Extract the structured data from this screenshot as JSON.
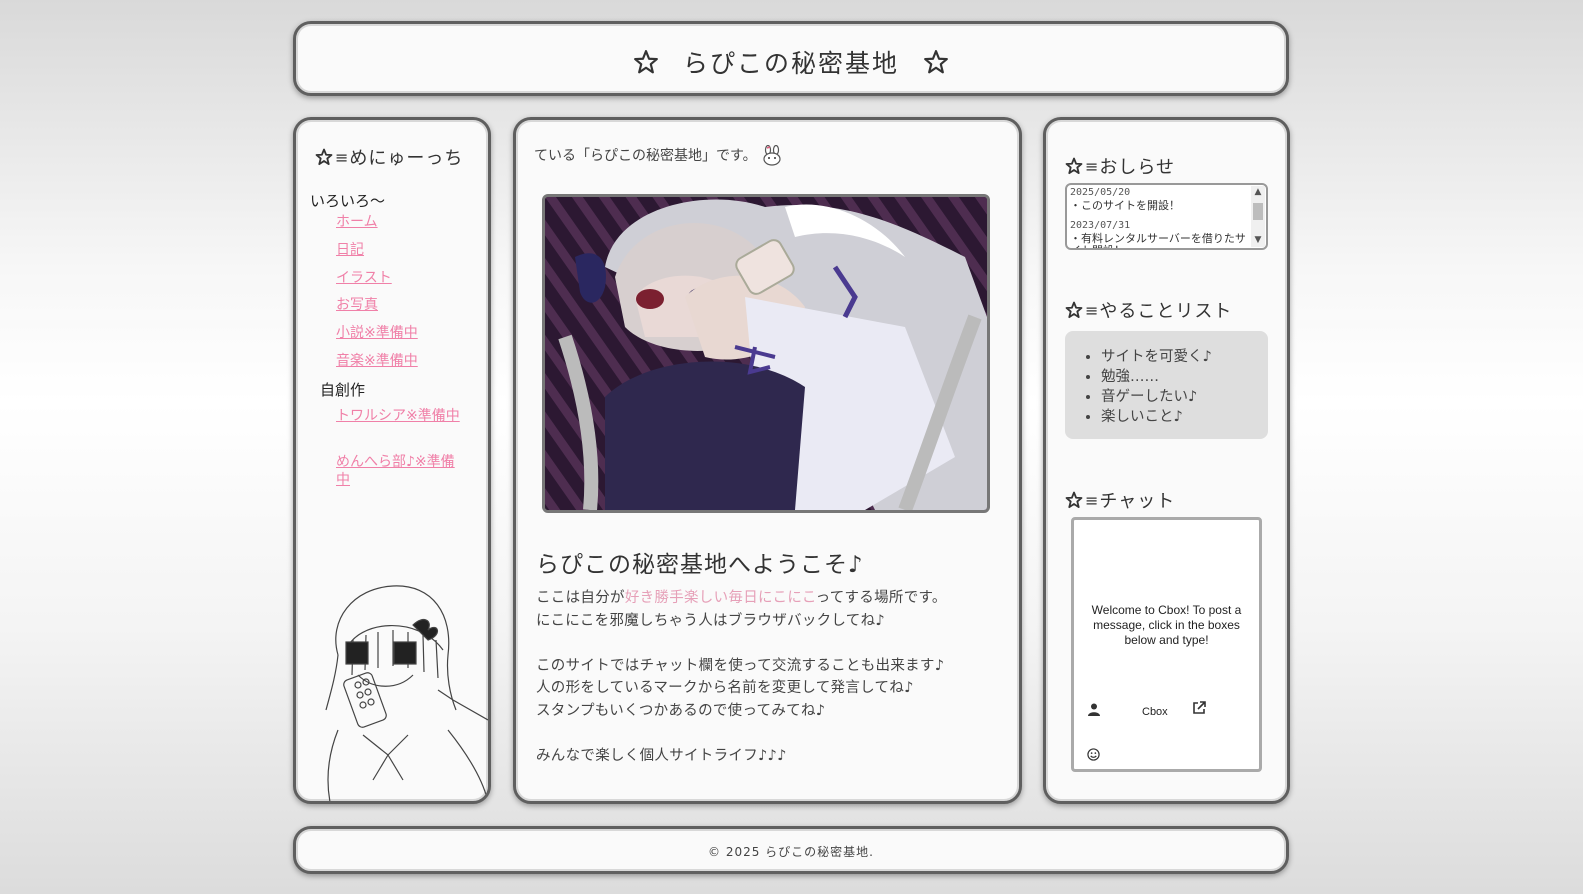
{
  "header": {
    "title": "らぴこの秘密基地"
  },
  "menu": {
    "title": "めにゅーっち",
    "groups": [
      {
        "label": "いろいろ～"
      },
      {
        "label": "自創作"
      }
    ],
    "links": [
      "ホーム",
      "日記",
      "イラスト",
      "お写真",
      "小説※準備中",
      "音楽※準備中",
      "トワルシア※準備中",
      "めんへら部♪※準備中"
    ]
  },
  "main": {
    "marquee": "ている「らぴこの秘密基地」です。",
    "welcome_title": "らぴこの秘密基地へようこそ♪",
    "p1_pre": "ここは自分が",
    "p1_hl": "好き勝手楽しい毎日にこにこ",
    "p1_post": "ってする場所です。",
    "p2": "にこにこを邪魔しちゃう人はブラウザバックしてね♪",
    "p3": "このサイトではチャット欄を使って交流することも出来ます♪",
    "p4": "人の形をしているマークから名前を変更して発言してね♪",
    "p5": "スタンプもいくつかあるので使ってみてね♪",
    "p6": "みんなで楽しく個人サイトライフ♪♪♪"
  },
  "news": {
    "title": "おしらせ",
    "items": [
      {
        "date": "2025/05/20",
        "text": "・このサイトを開設！"
      },
      {
        "date": "2023/07/31",
        "text": "・有料レンタルサーバーを借りたサイト開設！"
      }
    ]
  },
  "todo": {
    "title": "やることリスト",
    "items": [
      "サイトを可愛く♪",
      "勉強……",
      "音ゲーしたい♪",
      "楽しいこと♪"
    ]
  },
  "chat": {
    "title": "チャット",
    "welcome": "Welcome to Cbox! To post a message, click in the boxes below and type!",
    "brand": "Cbox"
  },
  "footer": {
    "copyright": "© 2025 らぴこの秘密基地."
  },
  "colors": {
    "link": "#f080a8",
    "border": "#5f5f5f",
    "todo_bg": "#dedede",
    "highlight": "#e6a0b8"
  }
}
